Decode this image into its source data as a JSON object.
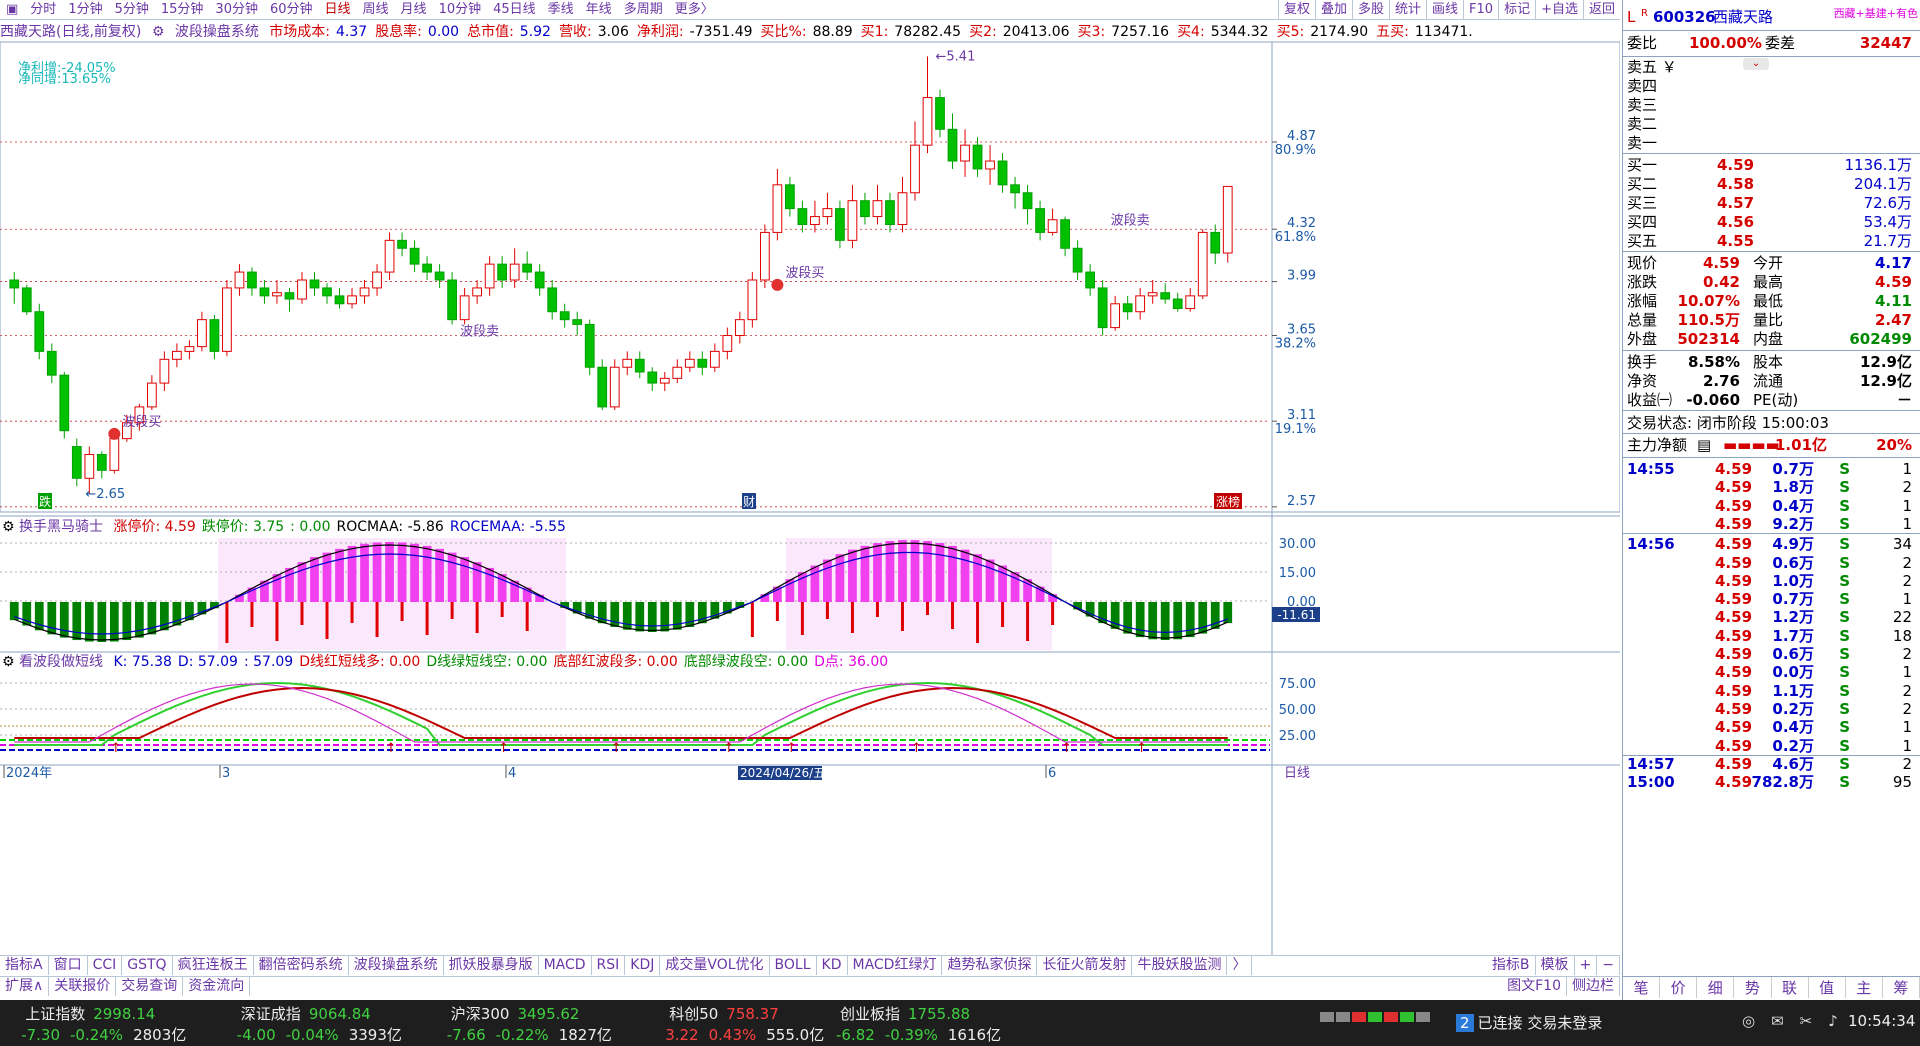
{
  "toolbar": {
    "periods": [
      "分时",
      "1分钟",
      "5分钟",
      "15分钟",
      "30分钟",
      "60分钟",
      "日线",
      "周线",
      "月线",
      "10分钟",
      "45日线",
      "季线",
      "年线",
      "多周期",
      "更多〉"
    ],
    "active_period": "日线",
    "right_buttons": [
      "复权",
      "叠加",
      "多股",
      "统计",
      "画线",
      "F10",
      "标记",
      "+自选",
      "返回"
    ]
  },
  "infobar": {
    "stock": "西藏天路(日线,前复权)",
    "indicator": "波段操盘系统",
    "items": [
      {
        "label": "市场成本:",
        "value": "4.37"
      },
      {
        "label": "股息率:",
        "value": "0.00"
      },
      {
        "label": "总市值:",
        "value": "5.92"
      },
      {
        "label": "营收:",
        "value": "3.06"
      },
      {
        "label": "净利润:",
        "value": "-7351.49"
      },
      {
        "label": "买比%:",
        "value": "88.89"
      },
      {
        "label": "买1:",
        "value": "78282.45"
      },
      {
        "label": "买2:",
        "value": "20413.06"
      },
      {
        "label": "买3:",
        "value": "7257.16"
      },
      {
        "label": "买4:",
        "value": "5344.32"
      },
      {
        "label": "买5:",
        "value": "2174.90"
      },
      {
        "label": "五买:",
        "value": "113471."
      }
    ]
  },
  "main_chart": {
    "overlay": [
      "净利增:-24.05%",
      "净同增:13.65%"
    ],
    "price_axis": [
      {
        "price": "4.87",
        "pct": "80.9%"
      },
      {
        "price": "4.32",
        "pct": "61.8%"
      },
      {
        "price": "3.99",
        "pct": ""
      },
      {
        "price": "3.65",
        "pct": "38.2%"
      },
      {
        "price": "3.11",
        "pct": "19.1%"
      },
      {
        "price": "2.57",
        "pct": ""
      }
    ],
    "high_label": "5.41",
    "low_label": "2.65",
    "signal_label": "波段买",
    "signal_sell": "波段卖",
    "tags": {
      "left": "跌",
      "mid": "财",
      "right": "涨榜"
    }
  },
  "panel2": {
    "name": "换手黑马骑士",
    "items": [
      {
        "label": "涨停价:",
        "value": "4.59"
      },
      {
        "label": "跌停价:",
        "value": "3.75"
      },
      {
        "label": "",
        "value": ": 0.00"
      },
      {
        "label": "ROCMAA:",
        "value": "-5.86"
      },
      {
        "label": "ROCEMAA:",
        "value": "-5.55"
      }
    ],
    "axis": [
      "30.00",
      "15.00",
      "0.00",
      "-11.61"
    ]
  },
  "panel3": {
    "name": "看波段做短线",
    "items": [
      {
        "label": "K:",
        "value": "75.38"
      },
      {
        "label": "D:",
        "value": "57.09"
      },
      {
        "label": "",
        "value": ": 57.09"
      },
      {
        "label": "D线红短线多:",
        "value": "0.00"
      },
      {
        "label": "D线绿短线空:",
        "value": "0.00"
      },
      {
        "label": "底部红波段多:",
        "value": "0.00"
      },
      {
        "label": "底部绿波段空:",
        "value": "0.00"
      },
      {
        "label": "D点:",
        "value": "36.00"
      }
    ],
    "axis": [
      "75.00",
      "50.00",
      "25.00"
    ]
  },
  "date_axis": {
    "labels": [
      "2024年",
      "3",
      "4",
      "2024/04/26/五",
      "6"
    ],
    "period": "日线"
  },
  "bottom_tabs": [
    "指标A",
    "窗口",
    "CCI",
    "GSTQ",
    "疯狂连板王",
    "翻倍密码系统",
    "波段操盘系统",
    "抓妖股暴身版",
    "MACD",
    "RSI",
    "KDJ",
    "成交量VOL优化",
    "BOLL",
    "KD",
    "MACD红绿灯",
    "趋势私家侦探",
    "长征火箭发射",
    "牛股妖股监测",
    "〉"
  ],
  "bottom_tabs_right": [
    "指标B",
    "模板"
  ],
  "bottom_tabs2": [
    "扩展∧",
    "关联报价",
    "交易查询",
    "资金流向"
  ],
  "bottom_tabs2_right": [
    "图文F10",
    "侧边栏"
  ],
  "right_panel": {
    "code": "600326",
    "name": "西藏天路",
    "tag": "西藏+基建+有色",
    "weibi_label": "委比",
    "weibi": "100.00%",
    "weicha_label": "委差",
    "weicha": "32447",
    "sell_levels": [
      "卖五",
      "卖四",
      "卖三",
      "卖二",
      "卖一"
    ],
    "buy_levels": [
      {
        "label": "买一",
        "price": "4.59",
        "vol": "1136.1万"
      },
      {
        "label": "买二",
        "price": "4.58",
        "vol": "204.1万"
      },
      {
        "label": "买三",
        "price": "4.57",
        "vol": "72.6万"
      },
      {
        "label": "买四",
        "price": "4.56",
        "vol": "53.4万"
      },
      {
        "label": "买五",
        "price": "4.55",
        "vol": "21.7万"
      }
    ],
    "quote": [
      {
        "l1": "现价",
        "v1": "4.59",
        "l2": "今开",
        "v2": "4.17",
        "c2": "blu"
      },
      {
        "l1": "涨跌",
        "v1": "0.42",
        "l2": "最高",
        "v2": "4.59",
        "c2": "red"
      },
      {
        "l1": "涨幅",
        "v1": "10.07%",
        "l2": "最低",
        "v2": "4.11",
        "c2": "grn"
      },
      {
        "l1": "总量",
        "v1": "110.5万",
        "l2": "量比",
        "v2": "2.47",
        "c2": "red"
      },
      {
        "l1": "外盘",
        "v1": "502314",
        "l2": "内盘",
        "v2": "602499",
        "c2": "grn"
      }
    ],
    "fund": [
      {
        "l1": "换手",
        "v1": "8.58%",
        "l2": "股本",
        "v2": "12.9亿"
      },
      {
        "l1": "净资",
        "v1": "2.76",
        "l2": "流通",
        "v2": "12.9亿"
      },
      {
        "l1": "收益㈠",
        "v1": "-0.060",
        "l2": "PE(动)",
        "v2": "－"
      }
    ],
    "trade_status": "交易状态: 闭市阶段 15:00:03",
    "main_net_label": "主力净额",
    "main_net": "1.01亿",
    "main_pct": "20%",
    "ticks": [
      {
        "t": "14:55",
        "p": "4.59",
        "v": "0.7万",
        "s": "S",
        "n": "1"
      },
      {
        "t": "",
        "p": "4.59",
        "v": "1.8万",
        "s": "S",
        "n": "2"
      },
      {
        "t": "",
        "p": "4.59",
        "v": "0.4万",
        "s": "S",
        "n": "1"
      },
      {
        "t": "",
        "p": "4.59",
        "v": "9.2万",
        "s": "S",
        "n": "1"
      },
      {
        "t": "14:56",
        "p": "4.59",
        "v": "4.9万",
        "s": "S",
        "n": "34"
      },
      {
        "t": "",
        "p": "4.59",
        "v": "0.6万",
        "s": "S",
        "n": "2"
      },
      {
        "t": "",
        "p": "4.59",
        "v": "1.0万",
        "s": "S",
        "n": "2"
      },
      {
        "t": "",
        "p": "4.59",
        "v": "0.7万",
        "s": "S",
        "n": "1"
      },
      {
        "t": "",
        "p": "4.59",
        "v": "1.2万",
        "s": "S",
        "n": "22"
      },
      {
        "t": "",
        "p": "4.59",
        "v": "1.7万",
        "s": "S",
        "n": "18"
      },
      {
        "t": "",
        "p": "4.59",
        "v": "0.6万",
        "s": "S",
        "n": "2"
      },
      {
        "t": "",
        "p": "4.59",
        "v": "0.0万",
        "s": "S",
        "n": "1"
      },
      {
        "t": "",
        "p": "4.59",
        "v": "1.1万",
        "s": "S",
        "n": "2"
      },
      {
        "t": "",
        "p": "4.59",
        "v": "0.2万",
        "s": "S",
        "n": "2"
      },
      {
        "t": "",
        "p": "4.59",
        "v": "0.4万",
        "s": "S",
        "n": "1"
      },
      {
        "t": "",
        "p": "4.59",
        "v": "0.2万",
        "s": "S",
        "n": "1"
      },
      {
        "t": "14:57",
        "p": "4.59",
        "v": "4.6万",
        "s": "S",
        "n": "2"
      },
      {
        "t": "15:00",
        "p": "4.59",
        "v": "782.8万",
        "s": "S",
        "n": "95"
      }
    ],
    "tabs": [
      "笔",
      "价",
      "细",
      "势",
      "联",
      "值",
      "主",
      "筹"
    ]
  },
  "status": {
    "indices": [
      {
        "name": "上证指数",
        "value": "2998.14",
        "chg": "-7.30",
        "pct": "-0.24%",
        "amt": "2803亿"
      },
      {
        "name": "深证成指",
        "value": "9064.84",
        "chg": "-4.00",
        "pct": "-0.04%",
        "amt": "3393亿"
      },
      {
        "name": "沪深300",
        "value": "3495.62",
        "chg": "-7.66",
        "pct": "-0.22%",
        "amt": "1827亿"
      },
      {
        "name": "科创50",
        "value": "758.37",
        "chg": "3.22",
        "pct": "0.43%",
        "amt": "555.0亿"
      },
      {
        "name": "创业板指",
        "value": "1755.88",
        "chg": "-6.82",
        "pct": "-0.39%",
        "amt": "1616亿"
      }
    ],
    "conn_num": "2",
    "conn": "已连接 交易未登录",
    "time": "10:54:34"
  },
  "chart_data": {
    "type": "candlestick",
    "price_range": [
      2.57,
      5.41
    ],
    "candles": [
      [
        4.0,
        3.95,
        4.05,
        3.85
      ],
      [
        3.95,
        3.8,
        3.97,
        3.78
      ],
      [
        3.8,
        3.55,
        3.85,
        3.5
      ],
      [
        3.55,
        3.4,
        3.6,
        3.35
      ],
      [
        3.4,
        3.05,
        3.42,
        3.0
      ],
      [
        2.95,
        2.75,
        3.0,
        2.7
      ],
      [
        2.75,
        2.9,
        2.95,
        2.65
      ],
      [
        2.9,
        2.8,
        2.92,
        2.75
      ],
      [
        2.8,
        3.0,
        3.02,
        2.78
      ],
      [
        3.0,
        3.1,
        3.15,
        2.98
      ],
      [
        3.1,
        3.2,
        3.22,
        3.05
      ],
      [
        3.2,
        3.35,
        3.4,
        3.18
      ],
      [
        3.35,
        3.5,
        3.55,
        3.3
      ],
      [
        3.5,
        3.55,
        3.6,
        3.45
      ],
      [
        3.55,
        3.58,
        3.62,
        3.5
      ],
      [
        3.58,
        3.75,
        3.8,
        3.55
      ],
      [
        3.75,
        3.55,
        3.78,
        3.5
      ],
      [
        3.55,
        3.95,
        4.0,
        3.52
      ],
      [
        3.95,
        4.05,
        4.1,
        3.9
      ],
      [
        4.05,
        3.95,
        4.08,
        3.9
      ],
      [
        3.95,
        3.9,
        4.0,
        3.85
      ],
      [
        3.9,
        3.92,
        4.0,
        3.85
      ],
      [
        3.92,
        3.88,
        3.95,
        3.8
      ],
      [
        3.88,
        4.0,
        4.05,
        3.85
      ],
      [
        4.0,
        3.95,
        4.05,
        3.9
      ],
      [
        3.95,
        3.9,
        3.98,
        3.85
      ],
      [
        3.9,
        3.85,
        3.95,
        3.82
      ],
      [
        3.85,
        3.9,
        3.95,
        3.82
      ],
      [
        3.9,
        3.95,
        4.0,
        3.85
      ],
      [
        3.95,
        4.05,
        4.1,
        3.9
      ],
      [
        4.05,
        4.25,
        4.3,
        4.0
      ],
      [
        4.25,
        4.2,
        4.3,
        4.15
      ],
      [
        4.2,
        4.1,
        4.25,
        4.05
      ],
      [
        4.1,
        4.05,
        4.15,
        4.0
      ],
      [
        4.05,
        4.0,
        4.1,
        3.95
      ],
      [
        4.0,
        3.75,
        4.05,
        3.72
      ],
      [
        3.75,
        3.9,
        3.95,
        3.72
      ],
      [
        3.9,
        3.95,
        4.0,
        3.85
      ],
      [
        3.95,
        4.1,
        4.15,
        3.9
      ],
      [
        4.1,
        4.0,
        4.15,
        3.95
      ],
      [
        4.0,
        4.1,
        4.2,
        3.95
      ],
      [
        4.1,
        4.05,
        4.18,
        4.0
      ],
      [
        4.05,
        3.95,
        4.1,
        3.9
      ],
      [
        3.95,
        3.8,
        4.0,
        3.75
      ],
      [
        3.8,
        3.75,
        3.85,
        3.7
      ],
      [
        3.75,
        3.72,
        3.8,
        3.65
      ],
      [
        3.72,
        3.45,
        3.75,
        3.4
      ],
      [
        3.45,
        3.2,
        3.5,
        3.18
      ],
      [
        3.2,
        3.45,
        3.5,
        3.18
      ],
      [
        3.45,
        3.5,
        3.55,
        3.4
      ],
      [
        3.5,
        3.42,
        3.55,
        3.38
      ],
      [
        3.42,
        3.35,
        3.45,
        3.3
      ],
      [
        3.35,
        3.38,
        3.42,
        3.3
      ],
      [
        3.38,
        3.45,
        3.5,
        3.35
      ],
      [
        3.45,
        3.5,
        3.55,
        3.42
      ],
      [
        3.5,
        3.45,
        3.55,
        3.4
      ],
      [
        3.45,
        3.55,
        3.6,
        3.42
      ],
      [
        3.55,
        3.65,
        3.7,
        3.5
      ],
      [
        3.65,
        3.75,
        3.8,
        3.6
      ],
      [
        3.75,
        4.0,
        4.05,
        3.7
      ],
      [
        4.0,
        4.3,
        4.35,
        3.95
      ],
      [
        4.3,
        4.6,
        4.7,
        4.25
      ],
      [
        4.6,
        4.45,
        4.65,
        4.4
      ],
      [
        4.45,
        4.35,
        4.5,
        4.3
      ],
      [
        4.35,
        4.4,
        4.5,
        4.3
      ],
      [
        4.4,
        4.45,
        4.55,
        4.35
      ],
      [
        4.45,
        4.25,
        4.5,
        4.2
      ],
      [
        4.25,
        4.5,
        4.6,
        4.2
      ],
      [
        4.5,
        4.4,
        4.55,
        4.35
      ],
      [
        4.4,
        4.5,
        4.6,
        4.35
      ],
      [
        4.5,
        4.35,
        4.55,
        4.3
      ],
      [
        4.35,
        4.55,
        4.65,
        4.3
      ],
      [
        4.55,
        4.85,
        5.0,
        4.5
      ],
      [
        4.85,
        5.15,
        5.41,
        4.8
      ],
      [
        5.15,
        4.95,
        5.2,
        4.9
      ],
      [
        4.95,
        4.75,
        5.05,
        4.7
      ],
      [
        4.75,
        4.85,
        4.95,
        4.65
      ],
      [
        4.85,
        4.7,
        4.9,
        4.65
      ],
      [
        4.7,
        4.75,
        4.85,
        4.6
      ],
      [
        4.75,
        4.6,
        4.8,
        4.55
      ],
      [
        4.6,
        4.55,
        4.65,
        4.45
      ],
      [
        4.55,
        4.45,
        4.6,
        4.35
      ],
      [
        4.45,
        4.3,
        4.5,
        4.25
      ],
      [
        4.3,
        4.38,
        4.45,
        4.28
      ],
      [
        4.38,
        4.2,
        4.4,
        4.15
      ],
      [
        4.2,
        4.05,
        4.25,
        4.0
      ],
      [
        4.05,
        3.95,
        4.1,
        3.9
      ],
      [
        3.95,
        3.7,
        4.0,
        3.65
      ],
      [
        3.7,
        3.85,
        3.9,
        3.68
      ],
      [
        3.85,
        3.8,
        3.9,
        3.75
      ],
      [
        3.8,
        3.9,
        3.95,
        3.75
      ],
      [
        3.9,
        3.92,
        4.0,
        3.85
      ],
      [
        3.92,
        3.88,
        3.98,
        3.85
      ],
      [
        3.88,
        3.82,
        3.92,
        3.8
      ],
      [
        3.82,
        3.9,
        3.95,
        3.8
      ],
      [
        3.9,
        4.3,
        4.32,
        3.88
      ],
      [
        4.3,
        4.17,
        4.35,
        4.1
      ],
      [
        4.17,
        4.59,
        4.59,
        4.11
      ]
    ]
  }
}
